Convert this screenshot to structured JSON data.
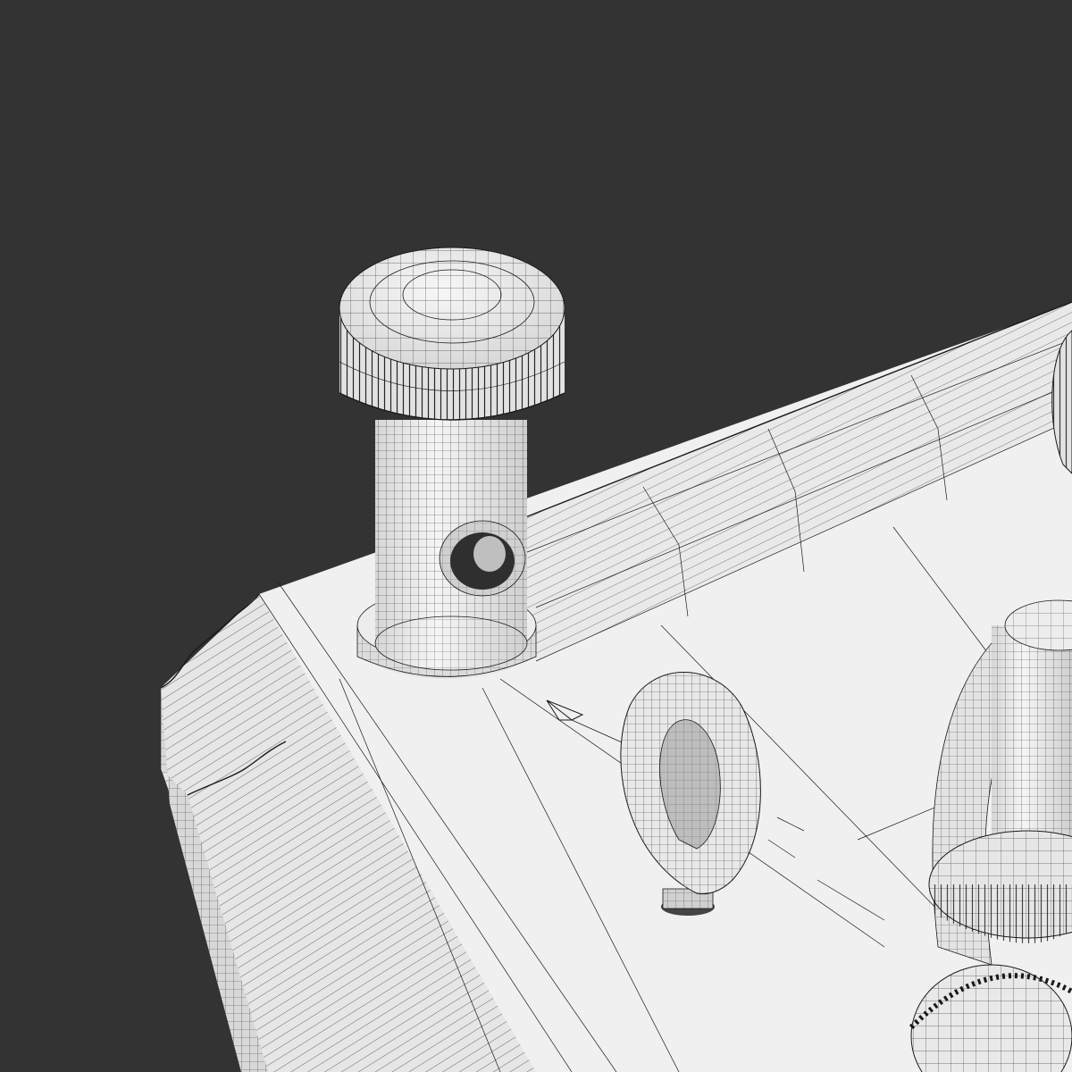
{
  "scene": {
    "background_color": "#333333",
    "surface_color": "#f2f2f2",
    "shade_color": "#d9d9d9",
    "wire_color": "#1a1a1a"
  }
}
